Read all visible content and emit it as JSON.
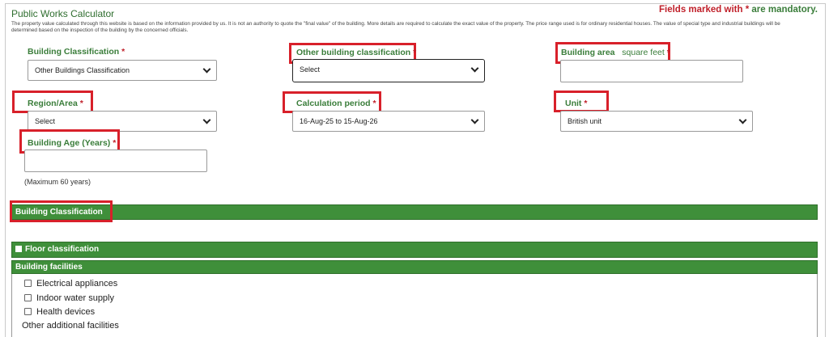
{
  "header": {
    "title": "Public Works Calculator",
    "mandatory_prefix": "Fields marked with ",
    "mandatory_star": "*",
    "mandatory_suffix": " are mandatory.",
    "disclaimer": "The property value calculated through this website is based on the information provided by us. It is not an authority to quote the \"final value\" of the building. More details are required to calculate the exact value of the property. The price range used is for ordinary residential houses. The value of special type and industrial buildings will be determined based on the inspection of the building by the concerned officials."
  },
  "form": {
    "required_mark": "*",
    "building_classification": {
      "label": "Building Classification",
      "value": "Other Buildings Classification"
    },
    "other_building_classification": {
      "label": "Other building classification",
      "value": "Select"
    },
    "building_area": {
      "label": "Building area",
      "unit": "square feet",
      "value": ""
    },
    "region_area": {
      "label": "Region/Area",
      "value": "Select"
    },
    "calculation_period": {
      "label": "Calculation period",
      "value": "16-Aug-25 to 15-Aug-26"
    },
    "unit": {
      "label": "Unit",
      "value": "British unit"
    },
    "building_age": {
      "label": "Building Age (Years)",
      "value": "",
      "hint": "(Maximum 60 years)"
    }
  },
  "sections": {
    "building_classification": "Building Classification",
    "floor_classification": "Floor classification",
    "building_facilities": "Building facilities"
  },
  "facilities": [
    {
      "label": "Electrical appliances",
      "checked": false
    },
    {
      "label": "Indoor water supply",
      "checked": false
    },
    {
      "label": "Health devices",
      "checked": false
    }
  ],
  "other_facilities_label": "Other additional facilities",
  "colors": {
    "accent_green": "#3f8f3a",
    "label_green": "#3a7d3a",
    "required_red": "#c0202a",
    "highlight_red": "#d8202a"
  }
}
